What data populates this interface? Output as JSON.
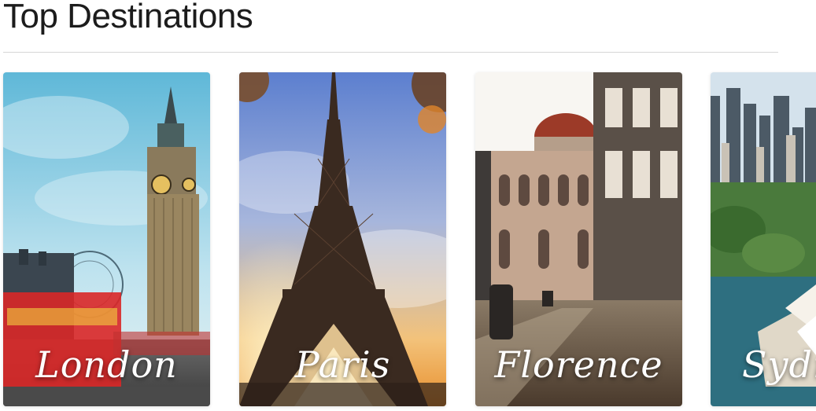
{
  "section": {
    "title": "Top Destinations"
  },
  "destinations": [
    {
      "name": "London",
      "image": "big-ben-image"
    },
    {
      "name": "Paris",
      "image": "eiffel-tower-image"
    },
    {
      "name": "Florence",
      "image": "florence-cathedral-image"
    },
    {
      "name": "Sydney",
      "image": "sydney-harbour-image"
    }
  ],
  "colors": {
    "title": "#1c1c1c",
    "divider": "#d6d6d6",
    "label": "#ffffff"
  }
}
